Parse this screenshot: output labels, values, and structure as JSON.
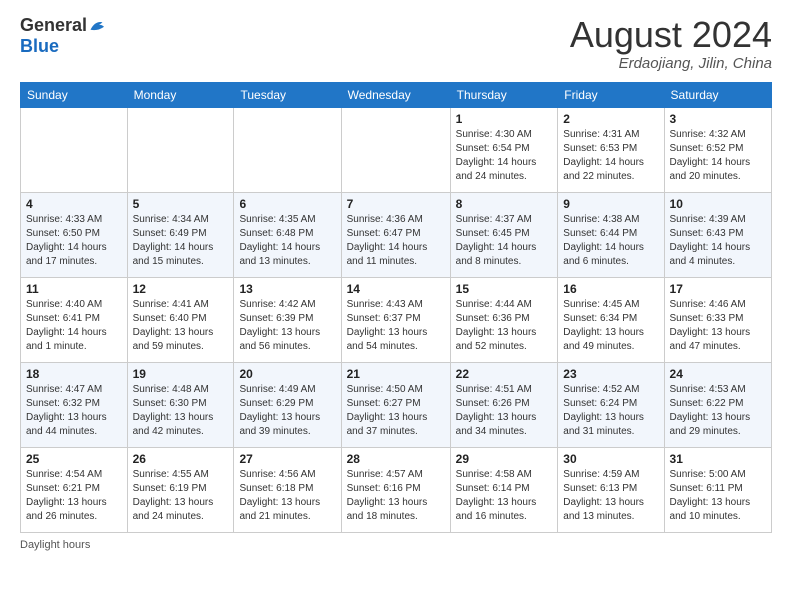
{
  "header": {
    "logo_general": "General",
    "logo_blue": "Blue",
    "month_title": "August 2024",
    "location": "Erdaojiang, Jilin, China"
  },
  "footer": {
    "daylight_label": "Daylight hours"
  },
  "days_of_week": [
    "Sunday",
    "Monday",
    "Tuesday",
    "Wednesday",
    "Thursday",
    "Friday",
    "Saturday"
  ],
  "weeks": [
    [
      {
        "num": "",
        "info": ""
      },
      {
        "num": "",
        "info": ""
      },
      {
        "num": "",
        "info": ""
      },
      {
        "num": "",
        "info": ""
      },
      {
        "num": "1",
        "info": "Sunrise: 4:30 AM\nSunset: 6:54 PM\nDaylight: 14 hours and 24 minutes."
      },
      {
        "num": "2",
        "info": "Sunrise: 4:31 AM\nSunset: 6:53 PM\nDaylight: 14 hours and 22 minutes."
      },
      {
        "num": "3",
        "info": "Sunrise: 4:32 AM\nSunset: 6:52 PM\nDaylight: 14 hours and 20 minutes."
      }
    ],
    [
      {
        "num": "4",
        "info": "Sunrise: 4:33 AM\nSunset: 6:50 PM\nDaylight: 14 hours and 17 minutes."
      },
      {
        "num": "5",
        "info": "Sunrise: 4:34 AM\nSunset: 6:49 PM\nDaylight: 14 hours and 15 minutes."
      },
      {
        "num": "6",
        "info": "Sunrise: 4:35 AM\nSunset: 6:48 PM\nDaylight: 14 hours and 13 minutes."
      },
      {
        "num": "7",
        "info": "Sunrise: 4:36 AM\nSunset: 6:47 PM\nDaylight: 14 hours and 11 minutes."
      },
      {
        "num": "8",
        "info": "Sunrise: 4:37 AM\nSunset: 6:45 PM\nDaylight: 14 hours and 8 minutes."
      },
      {
        "num": "9",
        "info": "Sunrise: 4:38 AM\nSunset: 6:44 PM\nDaylight: 14 hours and 6 minutes."
      },
      {
        "num": "10",
        "info": "Sunrise: 4:39 AM\nSunset: 6:43 PM\nDaylight: 14 hours and 4 minutes."
      }
    ],
    [
      {
        "num": "11",
        "info": "Sunrise: 4:40 AM\nSunset: 6:41 PM\nDaylight: 14 hours and 1 minute."
      },
      {
        "num": "12",
        "info": "Sunrise: 4:41 AM\nSunset: 6:40 PM\nDaylight: 13 hours and 59 minutes."
      },
      {
        "num": "13",
        "info": "Sunrise: 4:42 AM\nSunset: 6:39 PM\nDaylight: 13 hours and 56 minutes."
      },
      {
        "num": "14",
        "info": "Sunrise: 4:43 AM\nSunset: 6:37 PM\nDaylight: 13 hours and 54 minutes."
      },
      {
        "num": "15",
        "info": "Sunrise: 4:44 AM\nSunset: 6:36 PM\nDaylight: 13 hours and 52 minutes."
      },
      {
        "num": "16",
        "info": "Sunrise: 4:45 AM\nSunset: 6:34 PM\nDaylight: 13 hours and 49 minutes."
      },
      {
        "num": "17",
        "info": "Sunrise: 4:46 AM\nSunset: 6:33 PM\nDaylight: 13 hours and 47 minutes."
      }
    ],
    [
      {
        "num": "18",
        "info": "Sunrise: 4:47 AM\nSunset: 6:32 PM\nDaylight: 13 hours and 44 minutes."
      },
      {
        "num": "19",
        "info": "Sunrise: 4:48 AM\nSunset: 6:30 PM\nDaylight: 13 hours and 42 minutes."
      },
      {
        "num": "20",
        "info": "Sunrise: 4:49 AM\nSunset: 6:29 PM\nDaylight: 13 hours and 39 minutes."
      },
      {
        "num": "21",
        "info": "Sunrise: 4:50 AM\nSunset: 6:27 PM\nDaylight: 13 hours and 37 minutes."
      },
      {
        "num": "22",
        "info": "Sunrise: 4:51 AM\nSunset: 6:26 PM\nDaylight: 13 hours and 34 minutes."
      },
      {
        "num": "23",
        "info": "Sunrise: 4:52 AM\nSunset: 6:24 PM\nDaylight: 13 hours and 31 minutes."
      },
      {
        "num": "24",
        "info": "Sunrise: 4:53 AM\nSunset: 6:22 PM\nDaylight: 13 hours and 29 minutes."
      }
    ],
    [
      {
        "num": "25",
        "info": "Sunrise: 4:54 AM\nSunset: 6:21 PM\nDaylight: 13 hours and 26 minutes."
      },
      {
        "num": "26",
        "info": "Sunrise: 4:55 AM\nSunset: 6:19 PM\nDaylight: 13 hours and 24 minutes."
      },
      {
        "num": "27",
        "info": "Sunrise: 4:56 AM\nSunset: 6:18 PM\nDaylight: 13 hours and 21 minutes."
      },
      {
        "num": "28",
        "info": "Sunrise: 4:57 AM\nSunset: 6:16 PM\nDaylight: 13 hours and 18 minutes."
      },
      {
        "num": "29",
        "info": "Sunrise: 4:58 AM\nSunset: 6:14 PM\nDaylight: 13 hours and 16 minutes."
      },
      {
        "num": "30",
        "info": "Sunrise: 4:59 AM\nSunset: 6:13 PM\nDaylight: 13 hours and 13 minutes."
      },
      {
        "num": "31",
        "info": "Sunrise: 5:00 AM\nSunset: 6:11 PM\nDaylight: 13 hours and 10 minutes."
      }
    ]
  ]
}
